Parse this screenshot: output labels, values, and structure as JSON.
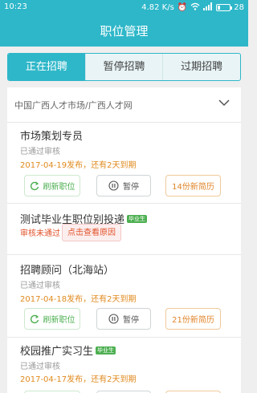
{
  "status_bar": {
    "time": "10:23",
    "net_speed": "4.82 K/s",
    "battery": "28"
  },
  "header": {
    "title": "职位管理"
  },
  "tabs": [
    {
      "label": "正在招聘",
      "active": true
    },
    {
      "label": "暂停招聘",
      "active": false
    },
    {
      "label": "过期招聘",
      "active": false
    }
  ],
  "filter": {
    "market": "中国广西人才市场/广西人才网"
  },
  "jobs": [
    {
      "title": "市场策划专员",
      "status": "已通过审核",
      "date_info": "2017-04-19发布，还有2天到期",
      "refresh_label": "刷新职位",
      "pause_label": "暂停",
      "resume_label": "14份新简历"
    },
    {
      "title": "测试毕业生职位别投递",
      "badge": "毕业生",
      "status": "审核未通过",
      "reason_label": "点击查看原因"
    },
    {
      "title": "招聘顾问（北海站）",
      "status": "已通过审核",
      "date_info": "2017-04-18发布，还有2天到期",
      "refresh_label": "刷新职位",
      "pause_label": "暂停",
      "resume_label": "21份新简历"
    },
    {
      "title": "校园推广实习生",
      "badge": "毕业生",
      "status": "已通过审核",
      "date_info": "2017-04-17发布，还有2天到期"
    }
  ]
}
